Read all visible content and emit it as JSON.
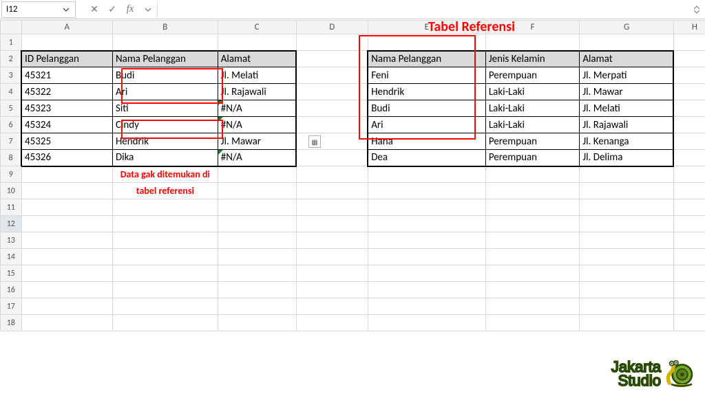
{
  "cellRef": "I12",
  "formulaValue": "",
  "columns": [
    "A",
    "B",
    "C",
    "D",
    "E",
    "F",
    "G",
    "H"
  ],
  "rowCount": 18,
  "annotations": {
    "title": "Tabel Referensi",
    "note1": "Data gak ditemukan di",
    "note2": "tabel referensi"
  },
  "table1": {
    "headers": {
      "a": "ID Pelanggan",
      "b": "Nama Pelanggan",
      "c": "Alamat"
    },
    "rows": [
      {
        "a": "45321",
        "b": "Budi",
        "c": "Jl. Melati"
      },
      {
        "a": "45322",
        "b": "Ari",
        "c": "Jl. Rajawali"
      },
      {
        "a": "45323",
        "b": "Siti",
        "c": "#N/A"
      },
      {
        "a": "45324",
        "b": "Cindy",
        "c": "#N/A"
      },
      {
        "a": "45325",
        "b": "Hendrik",
        "c": "Jl. Mawar"
      },
      {
        "a": "45326",
        "b": "Dika",
        "c": "#N/A"
      }
    ]
  },
  "table2": {
    "headers": {
      "e": "Nama Pelanggan",
      "f": "Jenis Kelamin",
      "g": "Alamat"
    },
    "rows": [
      {
        "e": "Feni",
        "f": "Perempuan",
        "g": "Jl. Merpati"
      },
      {
        "e": "Hendrik",
        "f": "Laki-Laki",
        "g": "Jl. Mawar"
      },
      {
        "e": "Budi",
        "f": "Laki-Laki",
        "g": "Jl. Melati"
      },
      {
        "e": "Ari",
        "f": "Laki-Laki",
        "g": "Jl. Rajawali"
      },
      {
        "e": "Hana",
        "f": "Perempuan",
        "g": "Jl. Kenanga"
      },
      {
        "e": "Dea",
        "f": "Perempuan",
        "g": "Jl. Delima"
      }
    ]
  },
  "watermark": {
    "line1": "Jakarta",
    "line2": "Studio"
  }
}
